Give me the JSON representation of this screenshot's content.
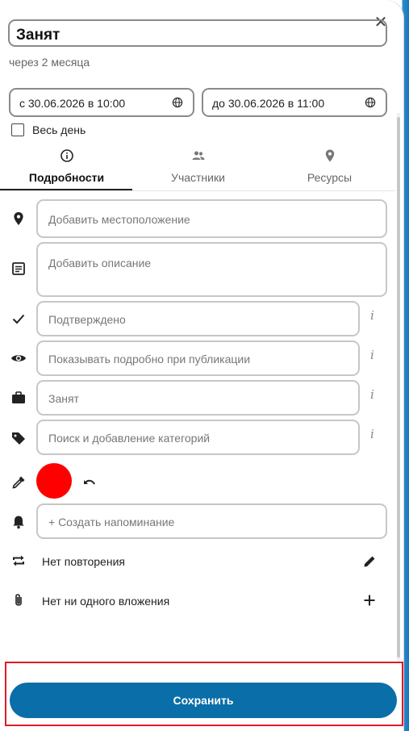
{
  "title": {
    "value": "Занят",
    "relative_time": "через 2 месяца"
  },
  "dates": {
    "start_label": "с 30.06.2026 в 10:00",
    "end_label": "до 30.06.2026 в 11:00"
  },
  "all_day": {
    "label": "Весь день",
    "checked": false
  },
  "tabs": [
    {
      "label": "Подробности",
      "icon": "info-icon",
      "active": true
    },
    {
      "label": "Участники",
      "icon": "people-icon",
      "active": false
    },
    {
      "label": "Ресурсы",
      "icon": "location-pin-icon",
      "active": false
    }
  ],
  "fields": {
    "location_placeholder": "Добавить местоположение",
    "description_placeholder": "Добавить описание",
    "status_value": "Подтверждено",
    "visibility_value": "Показывать подробно при публикации",
    "busy_value": "Занят",
    "category_placeholder": "Поиск и добавление категорий",
    "reminder_placeholder": "+ Создать напоминание"
  },
  "info_glyph": "i",
  "color": {
    "value": "#ff0000"
  },
  "repeat_label": "Нет повторения",
  "attachments_label": "Нет ни одного вложения",
  "save_label": "Сохранить",
  "close_glyph": "✕",
  "accent_color": "#0a6ea8"
}
